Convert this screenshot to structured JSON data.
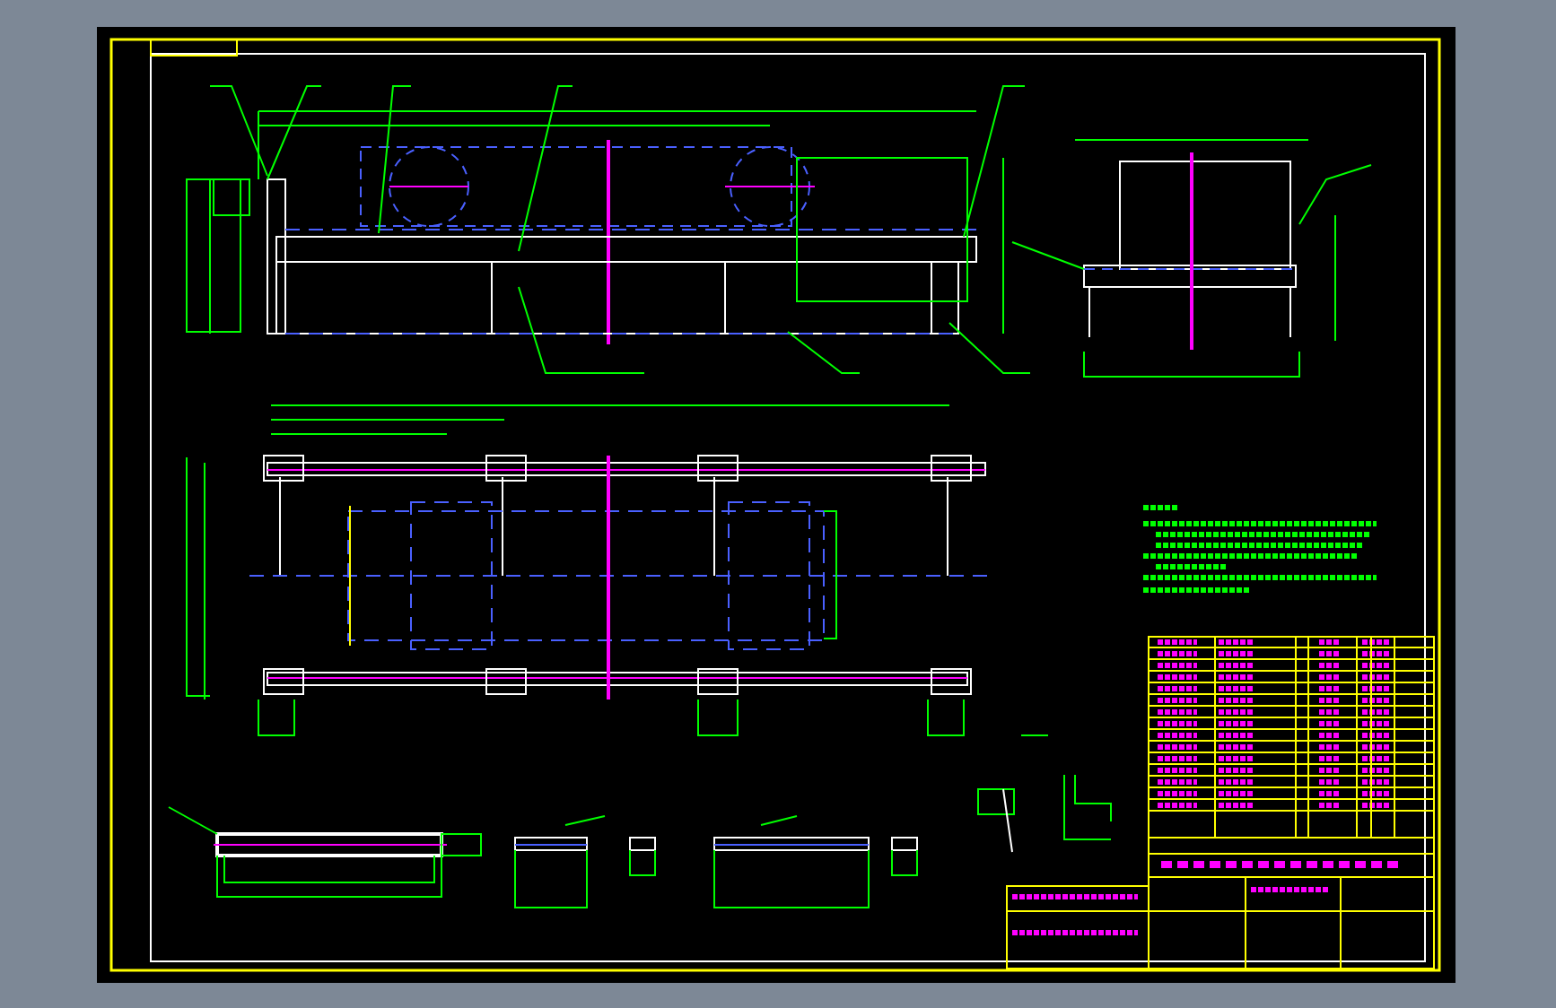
{
  "sheet": {
    "views": [
      {
        "kind": "elevation"
      },
      {
        "kind": "end-view"
      },
      {
        "kind": "plan"
      },
      {
        "kind": "section-long"
      },
      {
        "kind": "section-short"
      },
      {
        "kind": "section-mid"
      },
      {
        "kind": "detail"
      },
      {
        "kind": "notes"
      },
      {
        "kind": "parts-list"
      },
      {
        "kind": "title-block"
      }
    ]
  }
}
